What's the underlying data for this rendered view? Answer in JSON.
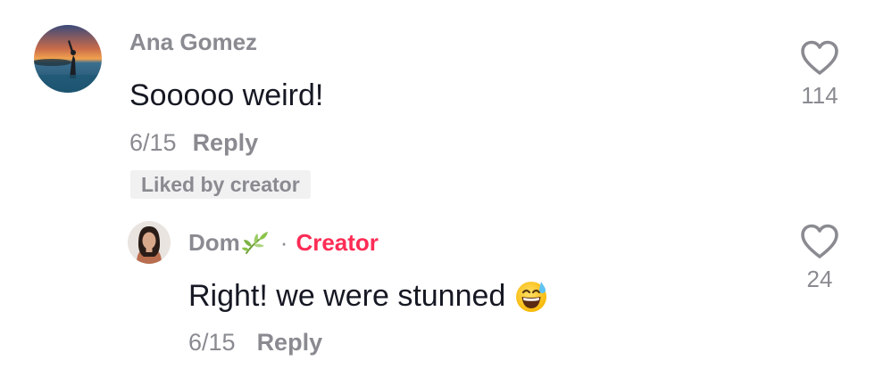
{
  "comment": {
    "avatar_icon": "sunset-beach-avatar",
    "username": "Ana Gomez",
    "text": "Sooooo weird!",
    "date": "6/15",
    "reply_label": "Reply",
    "liked_badge": "Liked by creator",
    "like_count": "114",
    "heart_icon": "heart-outline-icon"
  },
  "reply": {
    "avatar_icon": "woman-portrait-avatar",
    "username": "Dom",
    "username_emoji": "herb-leaf-emoji",
    "separator": "·",
    "creator_label": "Creator",
    "text": "Right! we were stunned",
    "text_emoji": "grinning-sweat-emoji",
    "date": "6/15",
    "reply_label": "Reply",
    "like_count": "24",
    "heart_icon": "heart-outline-icon"
  },
  "colors": {
    "primary_text": "#161823",
    "secondary_text": "#8a8b91",
    "creator_accent": "#fe2c55",
    "badge_bg": "#f1f1f2"
  }
}
